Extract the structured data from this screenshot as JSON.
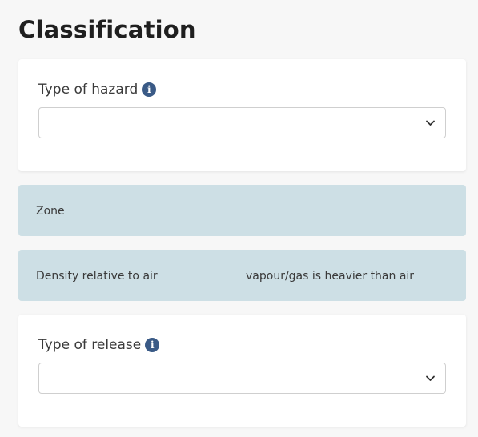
{
  "page": {
    "title": "Classification"
  },
  "hazard": {
    "label": "Type of hazard",
    "selected_value": ""
  },
  "zone": {
    "label": "Zone",
    "value": ""
  },
  "density": {
    "label": "Density relative to air",
    "value": "vapour/gas is heavier than air"
  },
  "release": {
    "label": "Type of release",
    "selected_value": ""
  },
  "icons": {
    "info": "info-icon",
    "dropdown": "chevron-down-icon"
  },
  "colors": {
    "background": "#f7f7f7",
    "panel": "#cddfe5",
    "info_icon": "#3a5a86"
  }
}
